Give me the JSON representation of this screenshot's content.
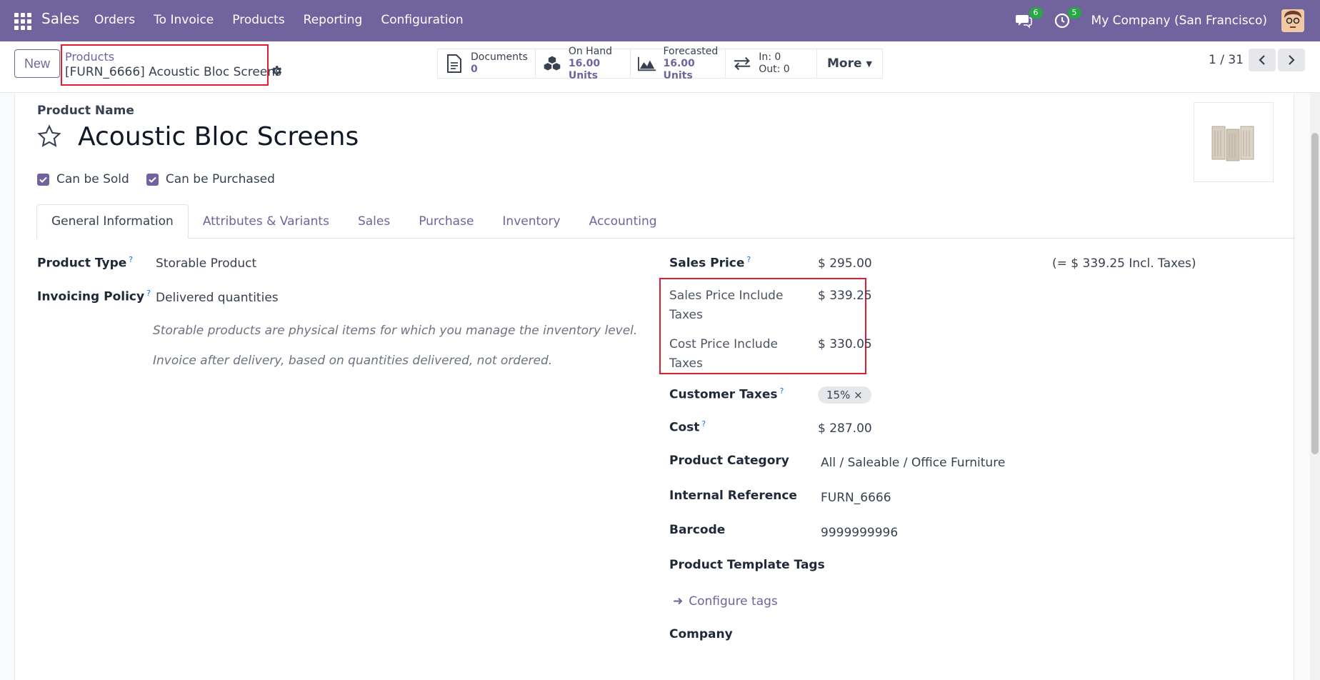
{
  "navbar": {
    "app_name": "Sales",
    "menu": [
      "Orders",
      "To Invoice",
      "Products",
      "Reporting",
      "Configuration"
    ],
    "messages_count": "6",
    "activities_count": "5",
    "company": "My Company (San Francisco)"
  },
  "control_panel": {
    "new_label": "New",
    "breadcrumb_parent": "Products",
    "breadcrumb_current": "[FURN_6666] Acoustic Bloc Screens",
    "smart_buttons": {
      "documents": {
        "label": "Documents",
        "value": "0"
      },
      "on_hand": {
        "label": "On Hand",
        "value": "16.00 Units"
      },
      "forecasted": {
        "label": "Forecasted",
        "value": "16.00 Units"
      },
      "in_out": {
        "in": "In: 0",
        "out": "Out: 0"
      },
      "more": "More"
    },
    "pager": "1 / 31"
  },
  "form": {
    "product_name_label": "Product Name",
    "product_name": "Acoustic Bloc Screens",
    "can_be_sold": "Can be Sold",
    "can_be_purchased": "Can be Purchased",
    "tabs": [
      "General Information",
      "Attributes & Variants",
      "Sales",
      "Purchase",
      "Inventory",
      "Accounting"
    ],
    "left": {
      "product_type_label": "Product Type",
      "product_type": "Storable Product",
      "invoicing_policy_label": "Invoicing Policy",
      "invoicing_policy": "Delivered quantities",
      "help1": "Storable products are physical items for which you manage the inventory level.",
      "help2": "Invoice after delivery, based on quantities delivered, not ordered."
    },
    "right": {
      "sales_price_label": "Sales Price",
      "sales_price": "$ 295.00",
      "incl_taxes": "(= $ 339.25 Incl. Taxes)",
      "sales_price_incl_label": "Sales Price Include Taxes",
      "sales_price_incl": "$ 339.25",
      "cost_price_incl_label": "Cost Price Include Taxes",
      "cost_price_incl": "$ 330.05",
      "customer_taxes_label": "Customer Taxes",
      "customer_tax_tag": "15% ×",
      "cost_label": "Cost",
      "cost": "$ 287.00",
      "category_label": "Product Category",
      "category": "All / Saleable / Office Furniture",
      "internal_ref_label": "Internal Reference",
      "internal_ref": "FURN_6666",
      "barcode_label": "Barcode",
      "barcode": "9999999996",
      "template_tags_label": "Product Template Tags",
      "configure_tags": "Configure tags",
      "company_label": "Company"
    }
  },
  "colors": {
    "primary": "#71639e",
    "highlight": "#e11d2f"
  }
}
